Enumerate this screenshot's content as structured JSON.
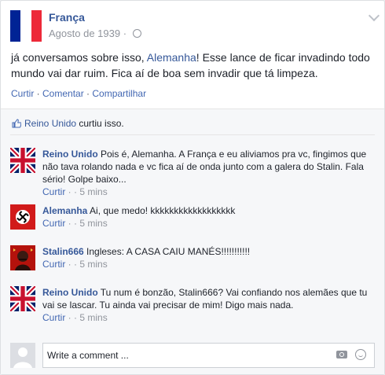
{
  "post": {
    "author": "França",
    "date": "Agosto de 1939",
    "meta_sep": " · ",
    "text_before": "já conversamos sobre isso, ",
    "mention": "Alemanha",
    "text_after": "! Esse lance de ficar invadindo todo mundo vai dar ruim. Fica aí de boa sem invadir que tá limpeza.",
    "actions": {
      "like": "Curtir",
      "comment": "Comentar",
      "share": "Compartilhar",
      "sep": " · "
    },
    "flag_colors": [
      "#002395",
      "#ffffff",
      "#ed2939"
    ]
  },
  "likes": {
    "name": "Reino Unido",
    "suffix": " curtiu isso."
  },
  "comments": [
    {
      "name": "Reino Unido",
      "text": " Pois é, Alemanha. A França e eu aliviamos pra vc, fingimos que não tava rolando nada e vc fica aí de onda junto com a galera do Stalin. Fala sério! Golpe baixo...",
      "like": "Curtir",
      "sep": " · · ",
      "time": "5 mins"
    },
    {
      "name": "Alemanha",
      "text": " Ai, que medo! kkkkkkkkkkkkkkkkkk",
      "like": "Curtir",
      "sep": " · · ",
      "time": "5 mins"
    },
    {
      "name": "Stalin666",
      "text": " Ingleses: A CASA CAIU MANÉS!!!!!!!!!!!",
      "like": "Curtir",
      "sep": " · · ",
      "time": "5 mins"
    },
    {
      "name": "Reino Unido",
      "text": " Tu num é bonzão, Stalin666? Vai confiando nos alemães que tu vai se lascar. Tu ainda vai precisar de mim! Digo mais nada.",
      "like": "Curtir",
      "sep": " · · ",
      "time": "5 mins"
    }
  ],
  "composer": {
    "placeholder": "Write a comment ..."
  },
  "colors": {
    "link": "#365899",
    "action": "#4267b2",
    "muted": "#90949c"
  }
}
